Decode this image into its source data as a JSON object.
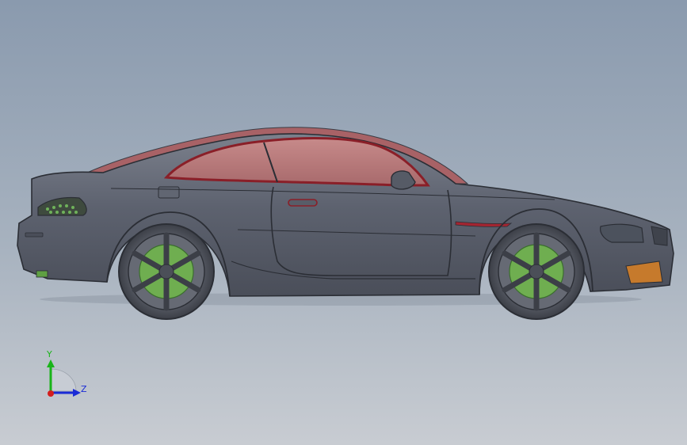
{
  "triad": {
    "y_label": "Y",
    "z_label": "Z",
    "colors": {
      "y_axis": "#19b419",
      "z_axis": "#1a2bd6",
      "x_axis": "#d41e1e",
      "plane": "#c7ccd4"
    }
  },
  "model": {
    "body_color": "#5d626f",
    "glass_color": "#b8787a",
    "trim_color": "#a32531",
    "caliper_color": "#5fa043",
    "indicator_color": "#c67a2c"
  },
  "background": {
    "top": "#8a9aae",
    "bottom": "#c8ccd2"
  }
}
